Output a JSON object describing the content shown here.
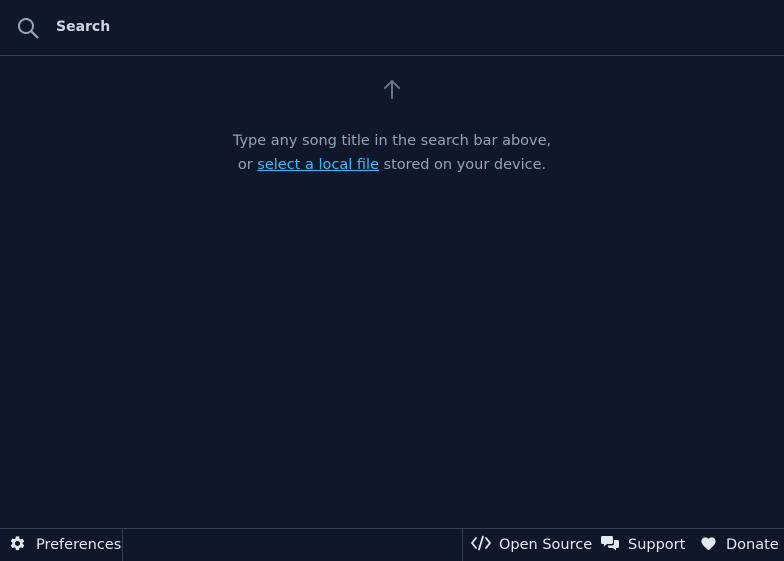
{
  "search": {
    "placeholder": "Search",
    "value": ""
  },
  "empty_state": {
    "line1": "Type any song title in the search bar above,",
    "line2_prefix": "or ",
    "link_text": "select a local file",
    "line2_suffix": " stored on your device."
  },
  "footer": {
    "preferences_label": "Preferences",
    "open_source_label": "Open Source",
    "support_label": "Support",
    "donate_label": "Donate"
  },
  "icons": {
    "search": "search-icon",
    "arrow": "arrow-up-icon",
    "preferences": "gear-icon",
    "open_source": "code-icon",
    "support": "chat-bubbles-icon",
    "donate": "heart-icon"
  },
  "colors": {
    "background": "#0f172a",
    "border": "#334155",
    "text": "#e2e8f0",
    "muted_text": "#94a3b8",
    "link": "#38bdf8"
  }
}
